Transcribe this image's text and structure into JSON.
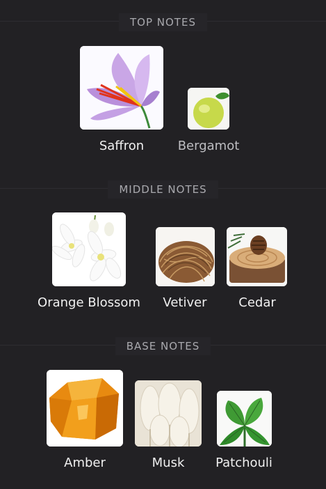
{
  "sections": [
    {
      "title": "TOP NOTES",
      "notes": [
        {
          "name": "Saffron",
          "icon": "saffron-flower-image"
        },
        {
          "name": "Bergamot",
          "icon": "bergamot-fruit-image"
        }
      ]
    },
    {
      "title": "MIDDLE NOTES",
      "notes": [
        {
          "name": "Orange Blossom",
          "icon": "orange-blossom-image"
        },
        {
          "name": "Vetiver",
          "icon": "vetiver-root-image"
        },
        {
          "name": "Cedar",
          "icon": "cedar-wood-image"
        }
      ]
    },
    {
      "title": "BASE NOTES",
      "notes": [
        {
          "name": "Amber",
          "icon": "amber-resin-image"
        },
        {
          "name": "Musk",
          "icon": "musk-fur-image"
        },
        {
          "name": "Patchouli",
          "icon": "patchouli-leaf-image"
        }
      ]
    }
  ],
  "colors": {
    "background": "#222124",
    "section_title": "#a9a9ae",
    "label": "#f0f0f0"
  }
}
